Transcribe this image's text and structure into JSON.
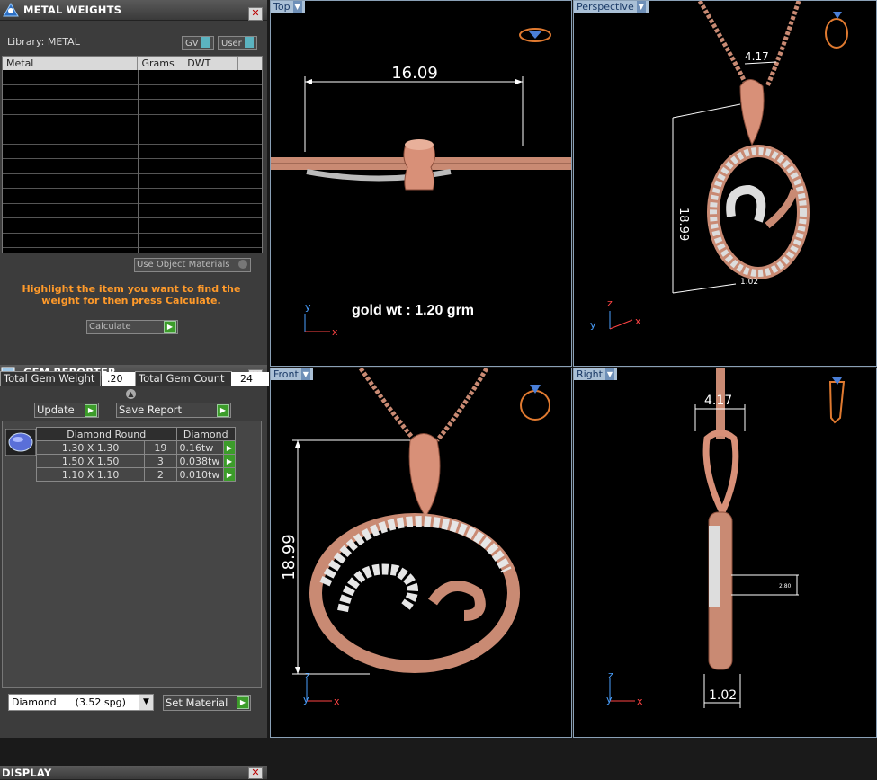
{
  "metal_weights": {
    "title": "METAL WEIGHTS",
    "library_label": "Library: METAL",
    "toggle_gv": "GV",
    "toggle_user": "User",
    "columns": [
      "Metal",
      "Grams",
      "DWT"
    ],
    "use_object_materials": "Use Object Materials",
    "message": "Highlight the item you want to find the weight for then press Calculate.",
    "calculate": "Calculate"
  },
  "gem_reporter": {
    "title": "GEM REPORTER",
    "total_gem_weight_label": "Total Gem Weight",
    "total_gem_weight_value": ".20",
    "total_gem_count_label": "Total Gem Count",
    "total_gem_count_value": "24",
    "update": "Update",
    "save_report": "Save Report",
    "table_headers": [
      "Diamond Round",
      "Diamond"
    ],
    "rows": [
      {
        "size": "1.30 X 1.30",
        "count": "19",
        "weight": "0.16tw"
      },
      {
        "size": "1.50 X 1.50",
        "count": "3",
        "weight": "0.038tw"
      },
      {
        "size": "1.10 X 1.10",
        "count": "2",
        "weight": "0.010tw"
      }
    ],
    "material_select": "Diamond      (3.52 spg)",
    "set_material": "Set Material"
  },
  "display": {
    "title": "DISPLAY"
  },
  "viewports": {
    "top": {
      "label": "Top",
      "dimension": "16.09",
      "annotation": "gold wt :  1.20 grm"
    },
    "perspective": {
      "label": "Perspective",
      "dim_width": "4.17",
      "dim_height": "18.99",
      "dim_small": "1.02"
    },
    "front": {
      "label": "Front",
      "dimension": "18.99"
    },
    "right": {
      "label": "Right",
      "dim_width": "4.17",
      "dim_bottom": "1.02",
      "dim_side": "2.80"
    }
  },
  "colors": {
    "orange": "#ff9a2a",
    "rose_gold": "#d89078",
    "viewport_border": "#8aa0b6"
  }
}
